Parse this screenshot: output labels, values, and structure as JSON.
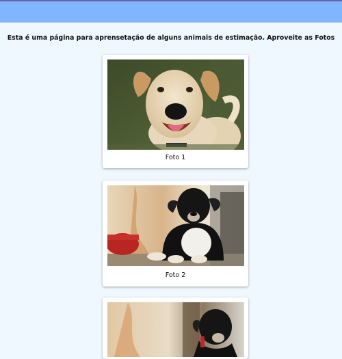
{
  "page": {
    "intro_text": "Esta é uma página para aprensetação de alguns animais de estimação. Aproveite as Fotos"
  },
  "gallery": {
    "items": [
      {
        "caption": "Foto 1",
        "alt": "dog-light"
      },
      {
        "caption": "Foto 2",
        "alt": "dog-black-white"
      },
      {
        "caption": "",
        "alt": "dog-black"
      }
    ]
  },
  "colors": {
    "header": "#80b6ff",
    "background": "#eff7ff",
    "card": "#ffffff"
  }
}
